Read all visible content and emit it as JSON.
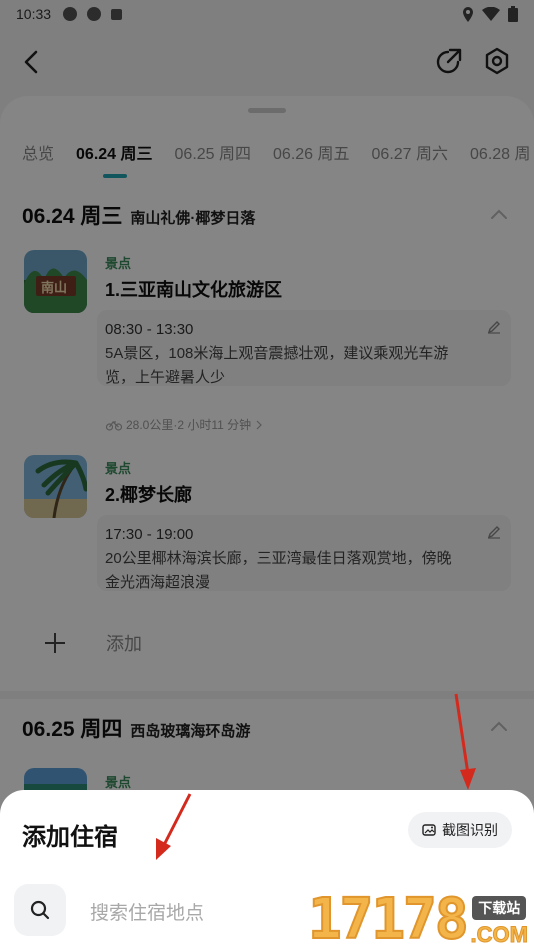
{
  "status_bar": {
    "time": "10:33"
  },
  "tabs": [
    {
      "label": "总览"
    },
    {
      "label": "06.24 周三"
    },
    {
      "label": "06.25 周四"
    },
    {
      "label": "06.26 周五"
    },
    {
      "label": "06.27 周六"
    },
    {
      "label": "06.28 周"
    }
  ],
  "days": [
    {
      "date": "06.24 周三",
      "theme": "南山礼佛·椰梦日落",
      "pois": [
        {
          "kind": "景点",
          "name": "1.三亚南山文化旅游区",
          "time": "08:30 - 13:30",
          "desc_line1": "5A景区，108米海上观音震撼壮观，建议乘观光车游",
          "desc_line2": "览，上午避暑人少",
          "thumb_text": "南山"
        },
        {
          "kind": "景点",
          "name": "2.椰梦长廊",
          "time": "17:30 - 19:00",
          "desc_line1": "20公里椰林海滨长廊，三亚湾最佳日落观赏地，傍晚",
          "desc_line2": "金光洒海超浪漫"
        }
      ],
      "transit": "28.0公里·2 小时11 分钟",
      "add_label": "添加"
    },
    {
      "date": "06.25 周四",
      "theme": "西岛玻璃海环岛游",
      "pois": [
        {
          "kind": "景点"
        }
      ]
    }
  ],
  "popup": {
    "title": "添加住宿",
    "ocr_label": "截图识别",
    "search_placeholder": "搜索住宿地点"
  },
  "watermark": {
    "digits": "17178",
    "badge": "下载站",
    "com": ".COM"
  },
  "colors": {
    "accent": "#22a6b3",
    "poi_kind": "#3b8a5a",
    "arrow": "#d42a1e",
    "watermark": "#f3b54a"
  }
}
